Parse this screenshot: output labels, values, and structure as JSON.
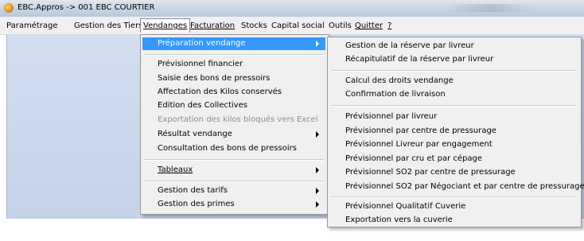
{
  "window": {
    "title": "EBC.Appros -> 001 EBC COURTIER"
  },
  "menubar": {
    "parametrage": "Paramétrage",
    "gestion_tiers": "Gestion des Tiers",
    "vendanges": "Vendanges",
    "facturation": "Facturation",
    "stocks": "Stocks",
    "capital_social": "Capital social",
    "outils": "Outils",
    "quitter": "Quitter",
    "help": "?"
  },
  "vendanges_menu": {
    "preparation": "Préparation vendange",
    "previsionnel_financier": "Prévisionnel financier",
    "saisie_bons": "Saisie des bons de pressoirs",
    "affectation_kilos": "Affectation des Kilos conservés",
    "edition_collectives": "Edition des Collectives",
    "exportation_kilos": "Exportation des kilos bloqués vers Excel",
    "resultat_vendange": "Résultat vendange",
    "consultation_bons": "Consultation des bons de pressoirs",
    "tableaux": "Tableaux",
    "gestion_tarifs": "Gestion des tarifs",
    "gestion_primes": "Gestion des primes"
  },
  "preparation_submenu": {
    "gestion_reserve": "Gestion de la réserve par livreur",
    "recap_reserve": "Récapitulatif de la réserve par livreur",
    "calcul_droits": "Calcul des droits vendange",
    "confirmation_livraison": "Confirmation de livraison",
    "prev_livreur": "Prévisionnel par livreur",
    "prev_centre": "Prévisionnel par centre de pressurage",
    "prev_engagement": "Prévisionnel Livreur par engagement",
    "prev_cru_cepage": "Prévisionnel par cru et par cépage",
    "prev_so2_centre": "Prévisionnel SO2 par centre de pressurage",
    "prev_so2_negociant": "Prévisionnel SO2 par Négociant et par centre de pressurage",
    "prev_qualitatif": "Prévisionnel Qualitatif Cuverie",
    "export_cuverie": "Exportation vers la cuverie"
  },
  "colors": {
    "highlight": "#3399ff",
    "menu_bg": "#f0f0f0",
    "client_bg": "#c8d6ea"
  }
}
